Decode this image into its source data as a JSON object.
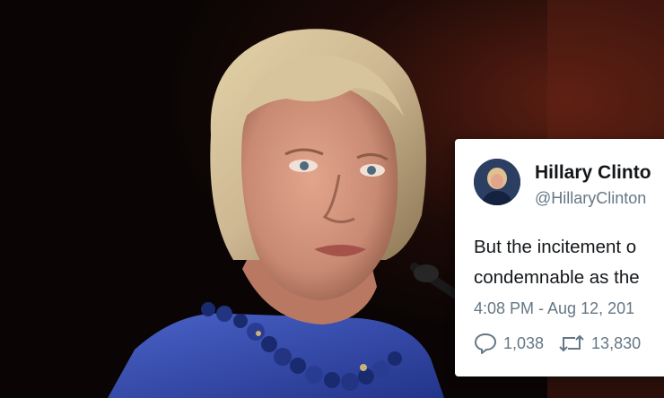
{
  "photo": {
    "description_icon": "portrait-photo",
    "background_color": "#0b0605",
    "jacket_color": "#3a51b0",
    "necklace_color": "#1a2a6e",
    "hair_color": "#cdb792"
  },
  "tweet": {
    "author_name": "Hillary Clinto",
    "author_handle": "@HillaryClinton",
    "text_lines": [
      "But the incitement o",
      "condemnable as the"
    ],
    "timestamp": "4:08 PM - Aug 12, 201",
    "replies": "1,038",
    "retweets": "13,830",
    "reply_icon": "reply-icon",
    "retweet_icon": "retweet-icon",
    "secondary_color": "#657786"
  }
}
